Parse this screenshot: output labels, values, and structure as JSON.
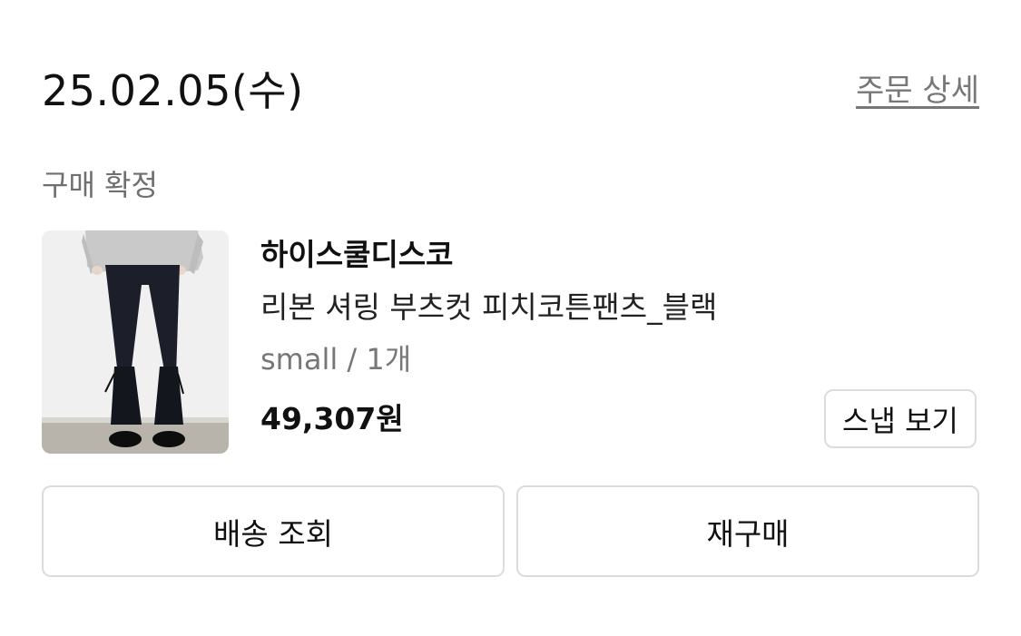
{
  "order": {
    "date": "25.02.05(수)",
    "detail_link": "주문 상세",
    "status": "구매 확정"
  },
  "product": {
    "image_alt": "black flared pants product photo",
    "brand": "하이스쿨디스코",
    "name": "리본 셔링 부츠컷 피치코튼팬츠_블랙",
    "option": "small / 1개",
    "price": "49,307원",
    "snap_label": "스냅 보기"
  },
  "actions": {
    "shipping_label": "배송 조회",
    "reorder_label": "재구매"
  }
}
